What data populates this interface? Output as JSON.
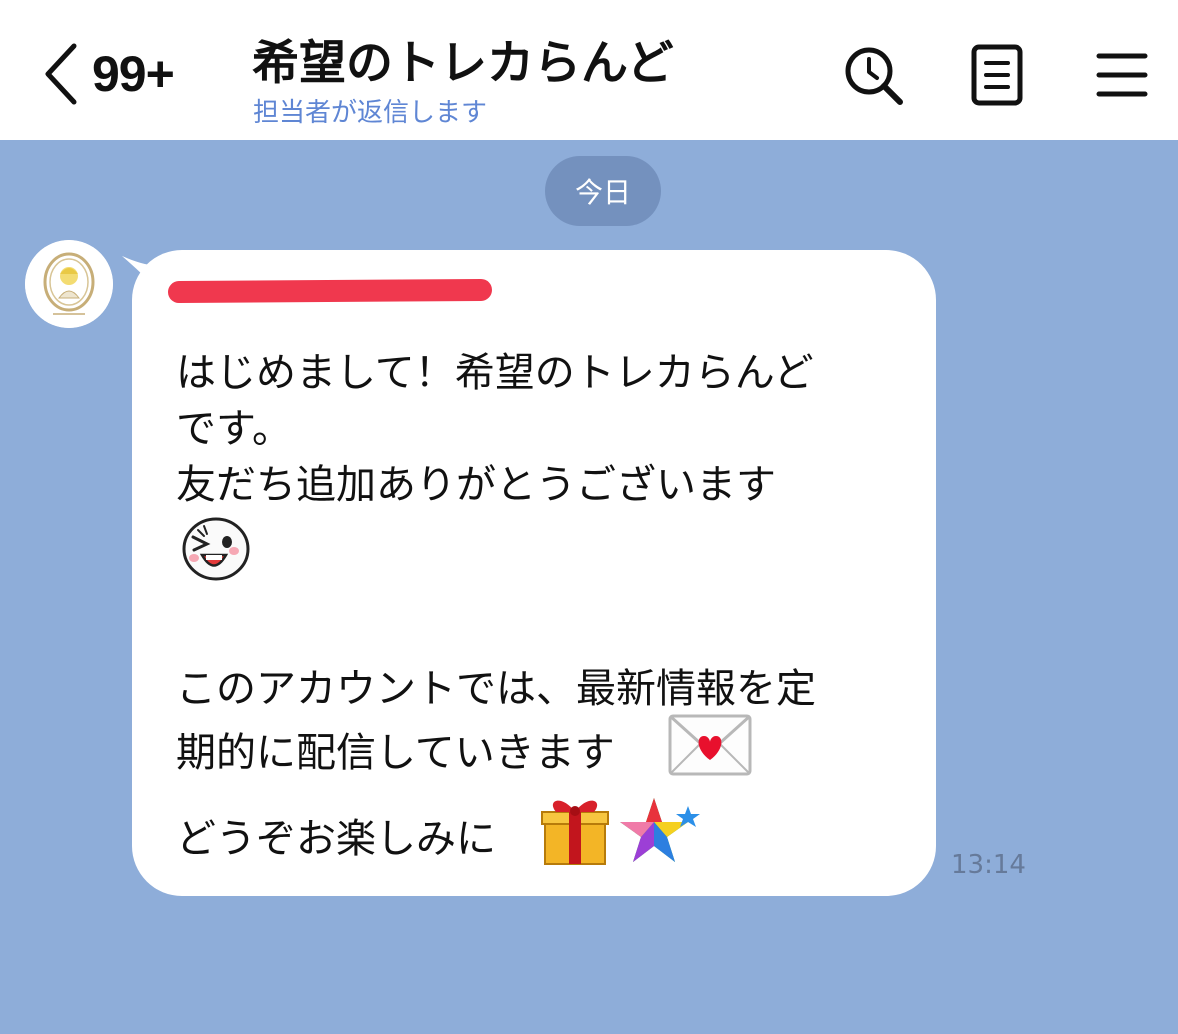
{
  "header": {
    "back_count": "99+",
    "title": "希望のトレカらんど",
    "subtitle": "担当者が返信します",
    "icons": [
      "back-chevron-icon",
      "search-icon",
      "notes-icon",
      "menu-icon"
    ]
  },
  "chat": {
    "date_label": "今日",
    "message": {
      "sender_avatar": "trading-card-shop-avatar",
      "lines": [
        "はじめまして！希望のトレカらんど",
        "です。",
        "友だち追加ありがとうございます",
        "このアカウントでは、最新情報を定",
        "期的に配信していきます",
        "どうぞお楽しみに"
      ],
      "emojis": [
        "winking-face-emoji",
        "love-letter-emoji",
        "gift-emoji",
        "sparkle-star-emoji"
      ],
      "time": "13:14"
    }
  },
  "colors": {
    "chat_background": "#8eadd9",
    "date_pill": "#7491be",
    "subtitle": "#5f86d4",
    "redaction": "#f0384e"
  }
}
